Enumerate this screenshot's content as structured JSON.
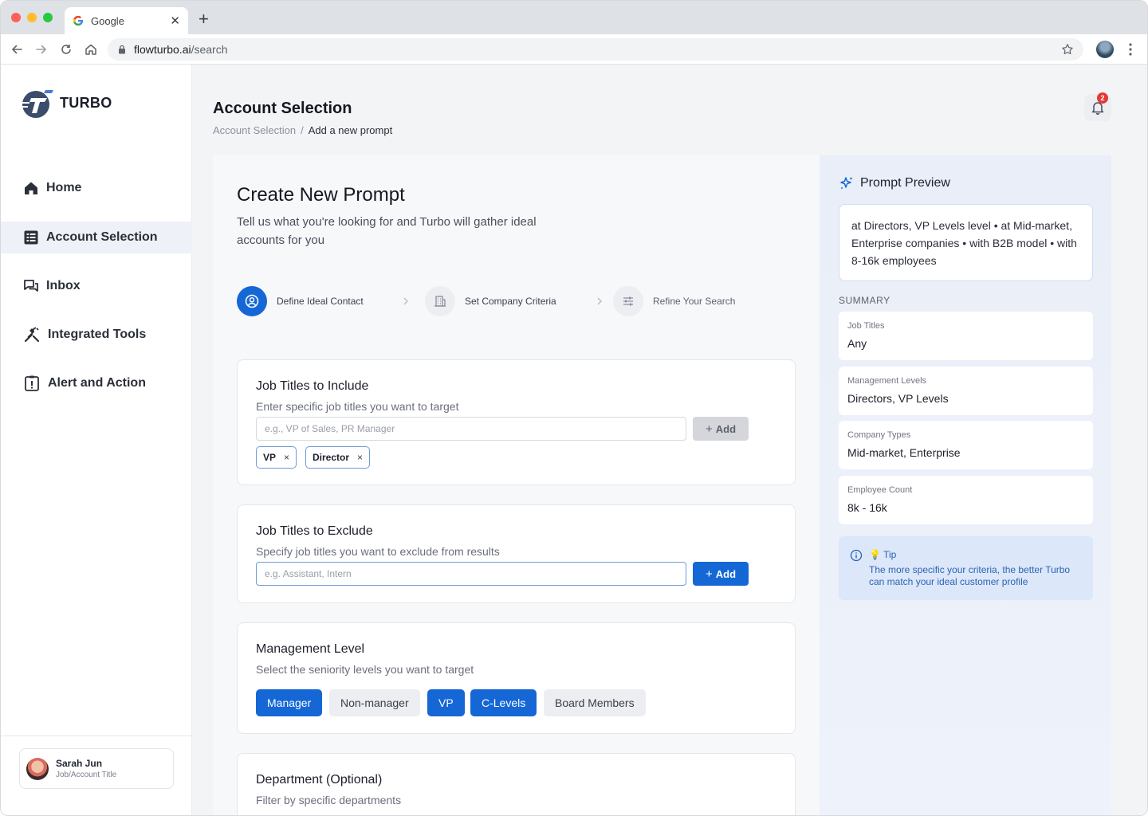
{
  "browser": {
    "tab_title": "Google",
    "tab_close": "✕",
    "new_tab": "+",
    "url_host": "flowturbo.ai",
    "url_path": "/search"
  },
  "brand": {
    "name": "TURBO"
  },
  "sidebar": {
    "items": [
      {
        "label": "Home",
        "icon": "home-icon",
        "active": false
      },
      {
        "label": "Account Selection",
        "icon": "list-icon",
        "active": true
      },
      {
        "label": "Inbox",
        "icon": "chat-icon",
        "active": false
      },
      {
        "label": "Integrated Tools",
        "icon": "tools-icon",
        "active": false
      },
      {
        "label": "Alert and Action",
        "icon": "alert-icon",
        "active": false
      }
    ],
    "user": {
      "name": "Sarah Jun",
      "role": "Job/Account Title"
    }
  },
  "header": {
    "title": "Account Selection",
    "breadcrumb": [
      "Account Selection",
      "/",
      "Add a new prompt"
    ],
    "notification_count": "2"
  },
  "form": {
    "title": "Create New Prompt",
    "subtitle": "Tell us what you're looking for and Turbo will gather ideal accounts for you",
    "steps": [
      {
        "label": "Define Ideal Contact",
        "active": true
      },
      {
        "label": "Set Company Criteria",
        "active": false
      },
      {
        "label": "Refine Your Search",
        "active": false
      }
    ],
    "include": {
      "title": "Job Titles to Include",
      "description": "Enter specific job titles you want to target",
      "placeholder": "e.g., VP of Sales, PR Manager",
      "value": "",
      "add_label": "Add",
      "chips": [
        {
          "label": "VP",
          "remove": "×"
        },
        {
          "label": "Director",
          "remove": "×"
        }
      ]
    },
    "exclude": {
      "title": "Job Titles to Exclude",
      "description": "Specify job titles you want to exclude from results",
      "placeholder": "e.g. Assistant, Intern",
      "value": "",
      "add_label": "Add"
    },
    "management": {
      "title": "Management Level",
      "description": "Select the seniority levels you want to target",
      "levels": [
        {
          "label": "Manager",
          "selected": true
        },
        {
          "label": "Non-manager",
          "selected": false
        },
        {
          "label": "VP",
          "selected": true
        },
        {
          "label": "C-Levels",
          "selected": true
        },
        {
          "label": "Board Members",
          "selected": false
        }
      ]
    },
    "department": {
      "title": "Department (Optional)",
      "description": "Filter by specific departments"
    }
  },
  "preview": {
    "title": "Prompt Preview",
    "text": "at Directors, VP Levels level • at Mid-market, Enterprise companies • with B2B model • with 8-16k employees",
    "summary_label": "SUMMARY",
    "summary": [
      {
        "key": "Job Titles",
        "value": "Any"
      },
      {
        "key": "Management Levels",
        "value": "Directors, VP Levels"
      },
      {
        "key": "Company Types",
        "value": "Mid-market, Enterprise"
      },
      {
        "key": "Employee Count",
        "value": "8k - 16k"
      }
    ],
    "tip": {
      "title": "💡 Tip",
      "text": "The more specific your criteria, the better Turbo can match your ideal customer profile"
    }
  },
  "colors": {
    "accent": "#1567d6",
    "badge": "#e53935",
    "tip_text": "#2c63b5"
  }
}
